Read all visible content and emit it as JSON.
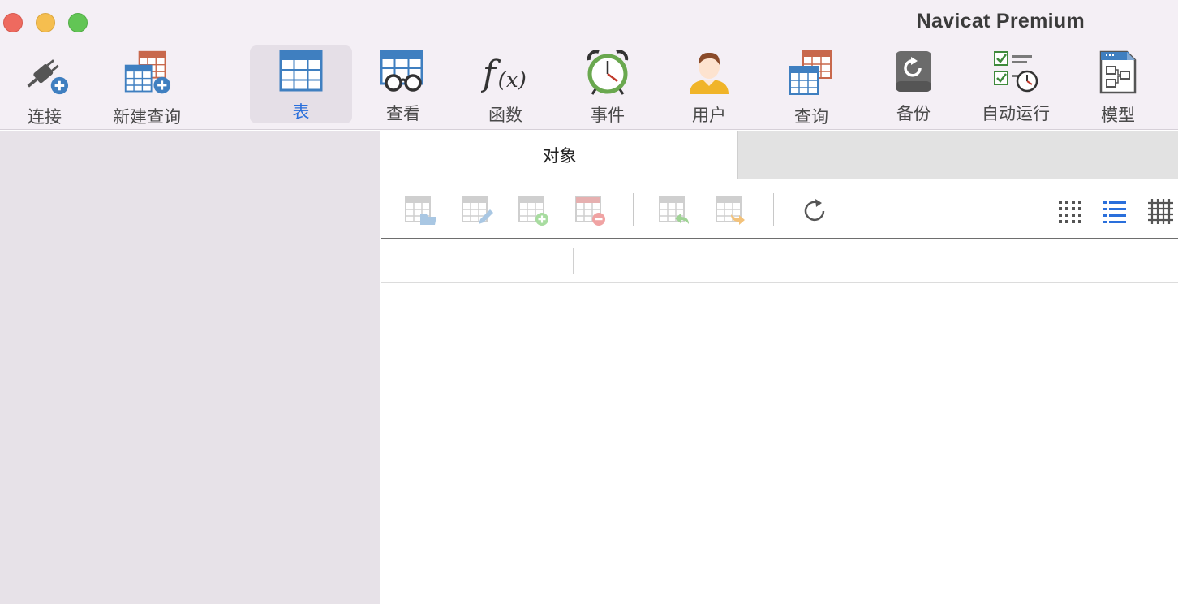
{
  "window": {
    "title": "Navicat Premium"
  },
  "toolbar": {
    "items": [
      {
        "label": "连接",
        "icon": "plug-add-icon"
      },
      {
        "label": "新建查询",
        "icon": "new-query-icon"
      },
      {
        "label": "表",
        "icon": "table-icon",
        "active": true
      },
      {
        "label": "查看",
        "icon": "view-glasses-icon"
      },
      {
        "label": "函数",
        "icon": "function-fx-icon"
      },
      {
        "label": "事件",
        "icon": "alarm-clock-icon"
      },
      {
        "label": "用户",
        "icon": "user-icon"
      },
      {
        "label": "查询",
        "icon": "query-icon"
      },
      {
        "label": "备份",
        "icon": "backup-icon"
      },
      {
        "label": "自动运行",
        "icon": "automation-icon"
      },
      {
        "label": "模型",
        "icon": "model-icon"
      }
    ]
  },
  "tabs": {
    "object_label": "对象"
  },
  "object_toolbar": {
    "buttons": [
      "open-table-icon",
      "design-table-icon",
      "new-table-icon",
      "delete-table-icon",
      "import-icon",
      "export-icon",
      "refresh-icon"
    ],
    "view_modes": [
      "grid-view-icon",
      "list-view-icon",
      "detail-view-icon"
    ],
    "active_view": "list-view-icon"
  },
  "colors": {
    "accent": "#2a6fdb",
    "sidebar_bg": "#e7e2e8",
    "toolbar_bg": "#f4eff5"
  }
}
